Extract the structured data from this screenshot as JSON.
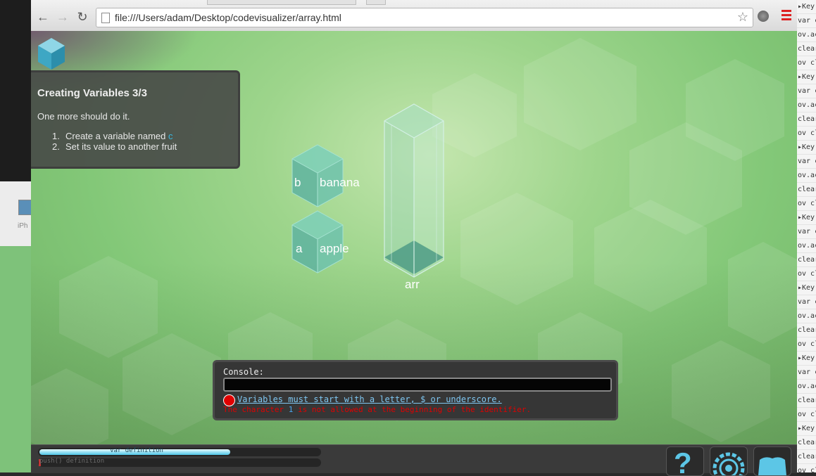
{
  "browser": {
    "url": "file:///Users/adam/Desktop/codevisualizer/array.html"
  },
  "desktop": {
    "left_label": "iPh",
    "log_lines": [
      "▸Key",
      "var c",
      "ov.ac",
      "clear",
      "ov cl",
      "▸Key",
      "var c",
      "ov.ac",
      "clear",
      "ov cl",
      "▸Key",
      "var c",
      "ov.ac",
      "clear",
      "ov cl",
      "▸Key",
      "var c",
      "ov.ac",
      "clear",
      "ov cl",
      "▸Key",
      "var c",
      "ov.ac",
      "clear",
      "ov cl",
      "▸Key",
      "var c",
      "ov.ac",
      "clear",
      "ov cl",
      "▸Key",
      "clear",
      "clear",
      "ov cl",
      "ov cl"
    ]
  },
  "lesson": {
    "title": "Creating Variables 3/3",
    "text": "One more should do it.",
    "steps": [
      {
        "num": "1.",
        "text": "Create a variable named ",
        "code": "c"
      },
      {
        "num": "2.",
        "text": "Set its value to another fruit",
        "code": ""
      }
    ]
  },
  "scene": {
    "variables": [
      {
        "name": "b",
        "value": "banana"
      },
      {
        "name": "a",
        "value": "apple"
      }
    ],
    "array": {
      "name": "arr"
    }
  },
  "console": {
    "label": "Console:",
    "input_value": "",
    "error_title": "Variables must start with a letter, $ or underscore.",
    "error_detail_pre": "The character ",
    "error_detail_code": "1",
    "error_detail_post": " is not allowed at the beginning of the identifier."
  },
  "progress": [
    {
      "label": "var definition",
      "fraction": 0.68,
      "state": "active"
    },
    {
      "label": "push() definition",
      "fraction": 0.0,
      "state": "pending"
    }
  ],
  "icons": {
    "logo": "cube-logo-icon",
    "help": "question-mark-icon",
    "settings": "gear-icon",
    "book": "book-icon"
  },
  "colors": {
    "accent": "#37b6df",
    "error": "#e00000",
    "cube": "#67b8a6"
  }
}
